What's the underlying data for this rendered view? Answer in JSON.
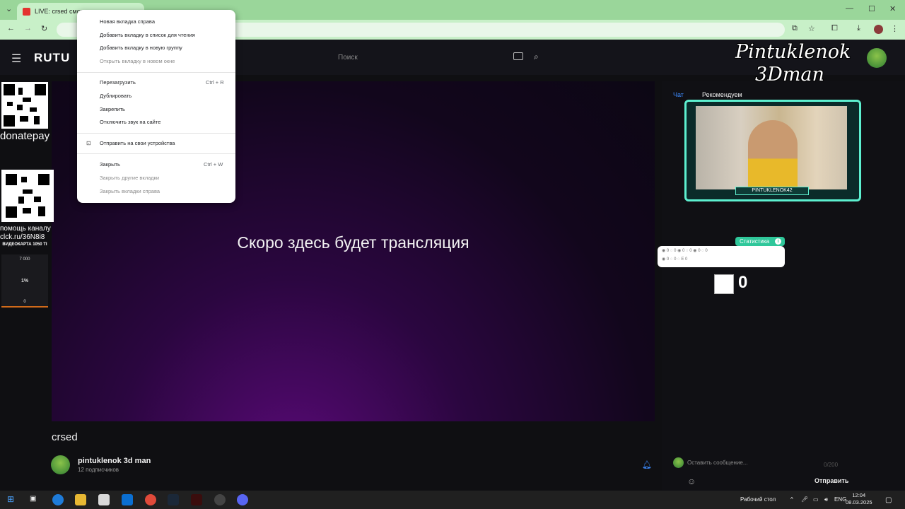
{
  "browser": {
    "tab_title": "LIVE: crsed смотр",
    "controls": {
      "minimize": "—",
      "maximize": "☐",
      "close": "✕"
    }
  },
  "site": {
    "logo": "RUTU",
    "search_placeholder": "Поиск"
  },
  "player": {
    "message": "Скоро здесь будет трансляция"
  },
  "video": {
    "title": "crsed",
    "channel_name": "pintuklenok 3d man",
    "subscribers": "12 подписчиков"
  },
  "overlay": {
    "donate_label": "donatepay",
    "help_line1": "помощь каналу",
    "help_line2": "clck.ru/36N8i8",
    "gpu_title": "ВИДЕОКАРТА 1050 TI",
    "gpu_target": "7 000",
    "gpu_percent": "1%",
    "gpu_current": "0",
    "streamer_name_line1": "Pintuklenok",
    "streamer_name_line2": "3Dman",
    "webcam_name": "PINTUKLENOK42",
    "stats_title": "Статистика",
    "stats_line1": "◉ 0 ◌ 0 ◉ 0 ◌ 0 ◉ 0 ◌ 0",
    "stats_line2": "◉ 0 ◌ 0 ◌ E 0",
    "counter_value": "0"
  },
  "chat": {
    "tab_chat": "Чат",
    "tab_recommended": "Рекомендуем",
    "input_placeholder": "Оставить сообщение...",
    "char_count": "0/200",
    "send_label": "Отправить"
  },
  "context_menu": {
    "items": [
      {
        "label": "Новая вкладка справа",
        "shortcut": "",
        "disabled": false
      },
      {
        "label": "Добавить вкладку в список для чтения",
        "shortcut": "",
        "disabled": false
      },
      {
        "label": "Добавить вкладку в новую группу",
        "shortcut": "",
        "disabled": false
      },
      {
        "label": "Открыть вкладку в новом окне",
        "shortcut": "",
        "disabled": true
      },
      {
        "label": "Перезагрузить",
        "shortcut": "Ctrl + R",
        "disabled": false
      },
      {
        "label": "Дублировать",
        "shortcut": "",
        "disabled": false
      },
      {
        "label": "Закрепить",
        "shortcut": "",
        "disabled": false
      },
      {
        "label": "Отключить звук на сайте",
        "shortcut": "",
        "disabled": false
      },
      {
        "label": "Отправить на свои устройства",
        "shortcut": "",
        "disabled": false
      },
      {
        "label": "Закрыть",
        "shortcut": "Ctrl + W",
        "disabled": false
      },
      {
        "label": "Закрыть другие вкладки",
        "shortcut": "",
        "disabled": true
      },
      {
        "label": "Закрыть вкладки справа",
        "shortcut": "",
        "disabled": true
      }
    ]
  },
  "taskbar": {
    "desktop_label": "Рабочий стол",
    "language": "ENG",
    "time": "12:04",
    "date": "08.03.2025"
  }
}
